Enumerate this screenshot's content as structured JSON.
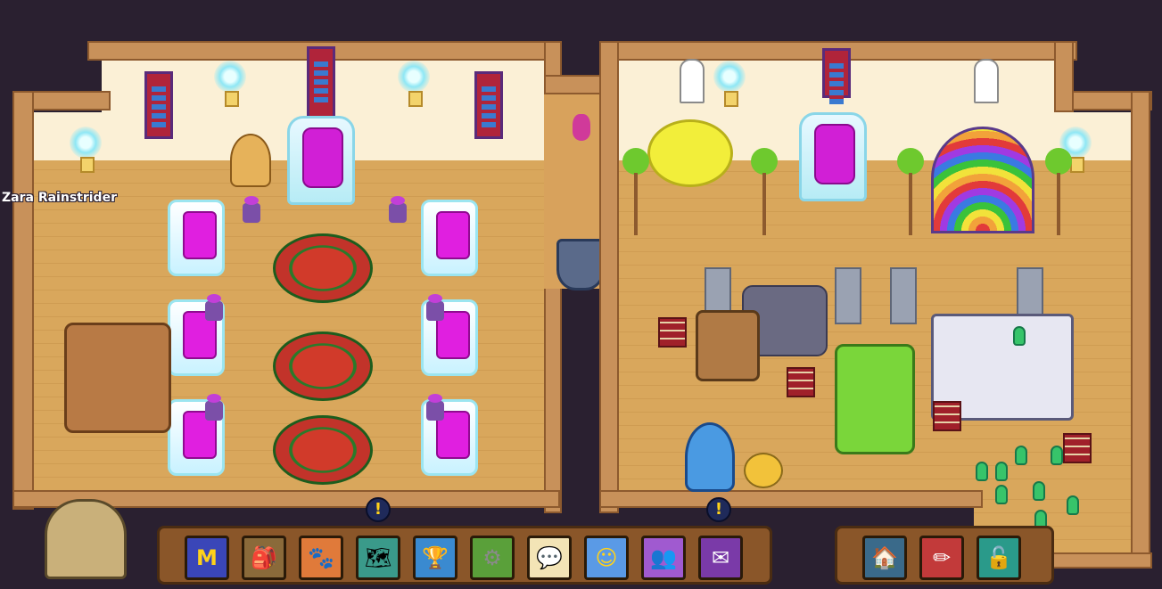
{
  "player": {
    "name": "Zara Rainstrider"
  },
  "toolbar": {
    "alert_glyph": "!",
    "main_buttons": [
      {
        "name": "membership-button",
        "icon": "membership-m-icon",
        "glyph": "M",
        "color": "#3a46b8"
      },
      {
        "name": "backpack-button",
        "icon": "backpack-icon",
        "glyph": "🎒",
        "color": "#8a6a3a"
      },
      {
        "name": "pets-button",
        "icon": "paw-icon",
        "glyph": "🐾",
        "color": "#e07a3a"
      },
      {
        "name": "map-button",
        "icon": "map-scroll-icon",
        "glyph": "🗺",
        "color": "#3a9a8a"
      },
      {
        "name": "achievements-button",
        "icon": "trophy-icon",
        "glyph": "🏆",
        "color": "#3a8ad0"
      },
      {
        "name": "settings-button",
        "icon": "gear-icon",
        "glyph": "⚙",
        "color": "#5aa03a"
      },
      {
        "name": "chat-button",
        "icon": "speech-bubble-icon",
        "glyph": "💬",
        "color": "#f3e4b6"
      },
      {
        "name": "emotes-button",
        "icon": "emotes-faces-icon",
        "glyph": "☺",
        "color": "#5a9ae6"
      },
      {
        "name": "friends-button",
        "icon": "friends-icon",
        "glyph": "👥",
        "color": "#a05ad0"
      },
      {
        "name": "mail-button",
        "icon": "envelope-icon",
        "glyph": "✉",
        "color": "#7a3aa8"
      }
    ],
    "house_buttons": [
      {
        "name": "house-home-button",
        "icon": "house-icon",
        "glyph": "🏠",
        "color": "#3a6a8a"
      },
      {
        "name": "house-edit-button",
        "icon": "house-edit-pencil-icon",
        "glyph": "✏",
        "color": "#c23a3a"
      },
      {
        "name": "house-visit-button",
        "icon": "house-unlock-icon",
        "glyph": "🔓",
        "color": "#2a9a8a"
      }
    ]
  }
}
